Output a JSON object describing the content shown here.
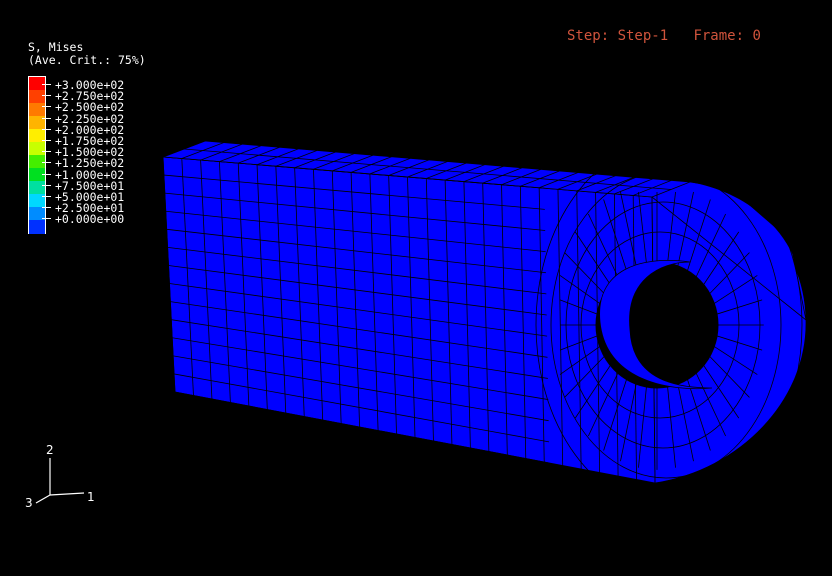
{
  "viewport": {
    "background": "#000000"
  },
  "legend": {
    "variable": "S, Mises",
    "averaging": "(Ave. Crit.: 75%)",
    "values": [
      "+3.000e+02",
      "+2.750e+02",
      "+2.500e+02",
      "+2.250e+02",
      "+2.000e+02",
      "+1.750e+02",
      "+1.500e+02",
      "+1.250e+02",
      "+1.000e+02",
      "+7.500e+01",
      "+5.000e+01",
      "+2.500e+01",
      "+0.000e+00"
    ],
    "colors": [
      "#ff0000",
      "#ff4000",
      "#ff7a00",
      "#ffb400",
      "#ffee00",
      "#c8ff00",
      "#44ee00",
      "#00e020",
      "#00e0a0",
      "#00d8ff",
      "#008cff",
      "#0030ff"
    ]
  },
  "status": {
    "step_text": "Step: Step-1",
    "frame_text": "Frame: 0",
    "color": "#d0543c"
  },
  "model": {
    "fill_color": "#0000ff",
    "mesh_color": "#000000"
  },
  "triad": {
    "axis_2": "2",
    "axis_3": "3",
    "axis_1": "1"
  }
}
